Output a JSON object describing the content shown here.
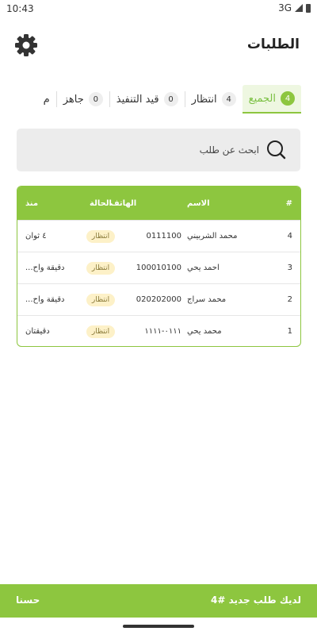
{
  "status_bar": {
    "time": "10:43",
    "network": "3G"
  },
  "header": {
    "title": "الطلبات",
    "settings_icon": "gear-icon"
  },
  "tabs": [
    {
      "label": "الجميع",
      "count": "4",
      "active": true
    },
    {
      "label": "انتظار",
      "count": "4"
    },
    {
      "label": "قيد التنفيذ",
      "count": "0"
    },
    {
      "label": "جاهز",
      "count": "0"
    },
    {
      "label": "م"
    }
  ],
  "search": {
    "placeholder": "ابحث عن طلب",
    "icon": "search-icon"
  },
  "table": {
    "columns": {
      "num": "#",
      "name": "الاسم",
      "phone": "الهاتف",
      "status": "الحالة",
      "since": "منذ"
    },
    "rows": [
      {
        "num": "4",
        "name": "محمد الشربيني",
        "phone": "0111100",
        "status": "انتظار",
        "since": "٤ ثوان"
      },
      {
        "num": "3",
        "name": "احمد يحي",
        "phone": "100010100",
        "status": "انتظار",
        "since": "دقيقة واح..."
      },
      {
        "num": "2",
        "name": "محمد سراج",
        "phone": "020202000",
        "status": "انتظار",
        "since": "دقيقة واح..."
      },
      {
        "num": "1",
        "name": "محمد يحي",
        "phone": "٠١١١-١١١١",
        "status": "انتظار",
        "since": "دقيقتان"
      }
    ]
  },
  "snackbar": {
    "message": "لديك طلب جديد #4",
    "action": "حسنا"
  },
  "colors": {
    "accent": "#8dc63f",
    "badge_bg": "#fdf1c8",
    "search_bg": "#ececec"
  }
}
